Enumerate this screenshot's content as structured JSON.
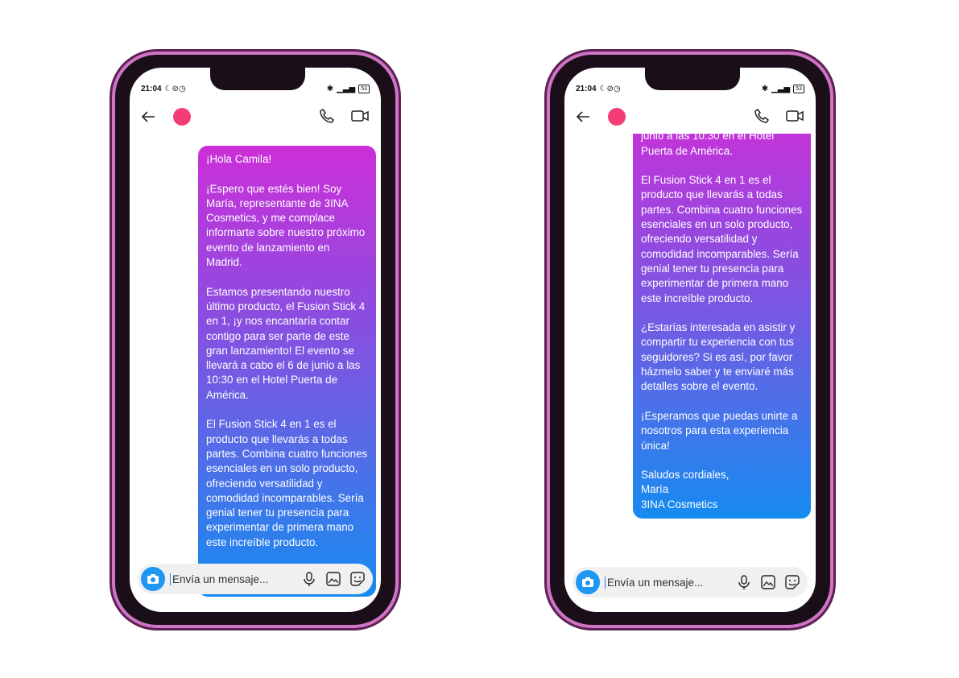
{
  "status": {
    "time": "21:04",
    "battery": "53"
  },
  "input": {
    "placeholder": "Envía un mensaje..."
  },
  "left": {
    "paragraphs": [
      "¡Hola Camila!",
      "¡Espero que estés bien! Soy María, representante de 3INA Cosmetics, y me complace informarte sobre nuestro próximo evento de lanzamiento en Madrid.",
      "Estamos presentando nuestro último producto, el Fusion Stick 4 en 1, ¡y nos encantaría contar contigo para ser parte de este gran lanzamiento! El evento se llevará a cabo el 6 de junio a las 10:30 en el Hotel Puerta de América.",
      "El Fusion Stick 4 en 1 es el producto que llevarás a todas partes. Combina cuatro funciones esenciales en un solo producto, ofreciendo versatilidad y comodidad incomparables. Sería genial tener tu presencia para experimentar de primera mano este increíble producto."
    ]
  },
  "right": {
    "paragraphs": [
      "evento se llevará a cabo el 6 de junio a las 10:30 en el Hotel Puerta de América.",
      "El Fusion Stick 4 en 1 es el producto que llevarás a todas partes. Combina cuatro funciones esenciales en un solo producto, ofreciendo versatilidad y comodidad incomparables. Sería genial tener tu presencia para experimentar de primera mano este increíble producto.",
      "¿Estarías interesada en asistir y compartir tu experiencia con tus seguidores? Si es así, por favor házmelo saber y te enviaré más detalles sobre el evento.",
      "¡Esperamos que puedas unirte a nosotros para esta experiencia única!",
      "Saludos cordiales,\nMaría\n3INA Cosmetics"
    ]
  }
}
